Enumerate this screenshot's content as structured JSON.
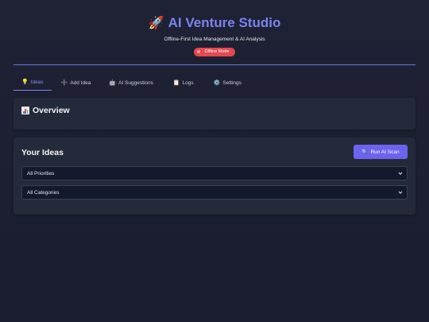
{
  "header": {
    "title": "AI Venture Studio",
    "subtitle": "Offline-First Idea Management & AI Analysis",
    "status_badge": "Offline Mode",
    "title_icon": "rocket-icon",
    "accent_color": "#7b84f0",
    "badge_color": "#e5484d"
  },
  "tabs": [
    {
      "label": "Ideas",
      "icon": "lightbulb-icon",
      "active": true
    },
    {
      "label": "Add Idea",
      "icon": "plus-icon",
      "active": false
    },
    {
      "label": "AI Suggestions",
      "icon": "robot-icon",
      "active": false
    },
    {
      "label": "Logs",
      "icon": "clipboard-icon",
      "active": false
    },
    {
      "label": "Settings",
      "icon": "gear-icon",
      "active": false
    }
  ],
  "overview": {
    "title": "Overview",
    "icon": "bar-chart-icon"
  },
  "ideas": {
    "title": "Your Ideas",
    "scan_button": "Run AI Scan",
    "scan_icon": "search-icon",
    "priority_filter": "All Priorities",
    "category_filter": "All Categories",
    "button_color": "#6c63f0"
  }
}
